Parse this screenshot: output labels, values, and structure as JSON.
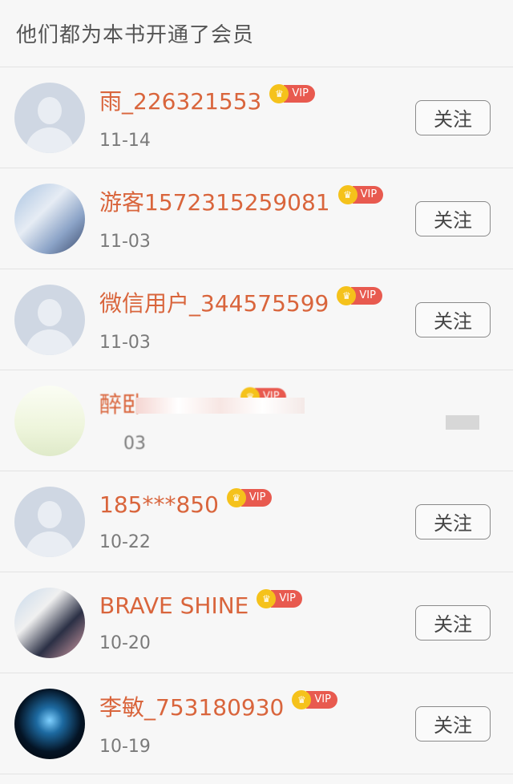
{
  "header": {
    "title": "他们都为本书开通了会员"
  },
  "vip_label": "VIP",
  "follow_label": "关注",
  "items": [
    {
      "name": "雨_226321553",
      "date": "11-14",
      "avatar": "default-avatar"
    },
    {
      "name": "游客1572315259081",
      "date": "11-03",
      "avatar": "anime-avatar"
    },
    {
      "name": "微信用户_344575599",
      "date": "11-03",
      "avatar": "default-avatar"
    },
    {
      "name": "醉卧",
      "date": "03",
      "avatar": "anime-avatar"
    },
    {
      "name": "185***850",
      "date": "10-22",
      "avatar": "default-avatar"
    },
    {
      "name": "BRAVE SHINE",
      "date": "10-20",
      "avatar": "anime-avatar"
    },
    {
      "name": "李敏_753180930",
      "date": "10-19",
      "avatar": "dark-avatar"
    }
  ],
  "colors": {
    "name": "#d9653c",
    "vip_badge": "#e85a4f",
    "crown": "#f5c21b"
  }
}
